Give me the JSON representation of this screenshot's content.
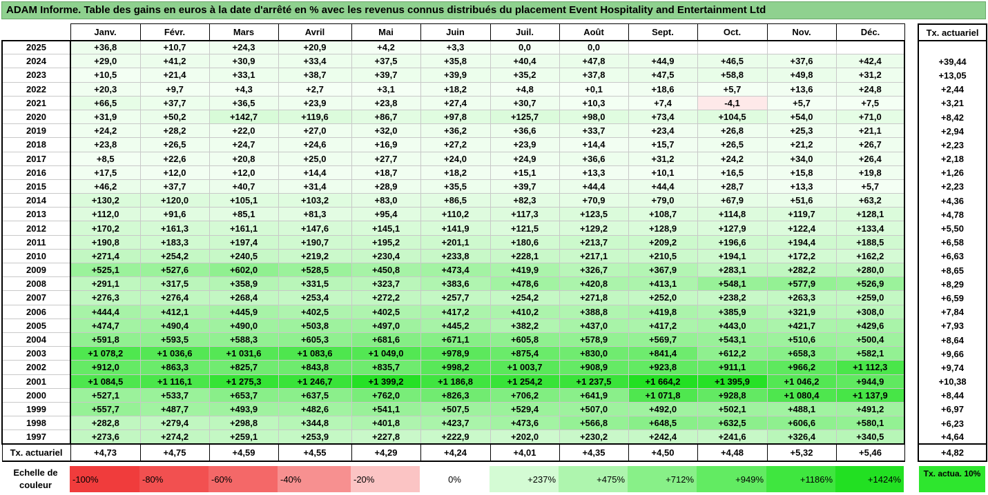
{
  "title": "ADAM Informe. Table des gains en euros à la date d'arrêté en % avec les revenus connus distribués du placement Event Hospitality and Entertainment Ltd",
  "chart_data": {
    "type": "table",
    "columns": [
      "Janv.",
      "Févr.",
      "Mars",
      "Avril",
      "Mai",
      "Juin",
      "Juil.",
      "Août",
      "Sept.",
      "Oct.",
      "Nov.",
      "Déc."
    ],
    "right_header": "Tx. actuariel",
    "rows": [
      {
        "year": "2025",
        "values": [
          "+36,8",
          "+10,7",
          "+24,3",
          "+20,9",
          "+4,2",
          "+3,3",
          "0,0",
          "0,0",
          "",
          "",
          "",
          ""
        ],
        "tx": ""
      },
      {
        "year": "2024",
        "values": [
          "+29,0",
          "+41,2",
          "+30,9",
          "+33,4",
          "+37,5",
          "+35,8",
          "+40,4",
          "+47,8",
          "+44,9",
          "+46,5",
          "+37,6",
          "+42,4"
        ],
        "tx": "+39,44"
      },
      {
        "year": "2023",
        "values": [
          "+10,5",
          "+21,4",
          "+33,1",
          "+38,7",
          "+39,7",
          "+39,9",
          "+35,2",
          "+37,8",
          "+47,5",
          "+58,8",
          "+49,8",
          "+31,2"
        ],
        "tx": "+13,05"
      },
      {
        "year": "2022",
        "values": [
          "+20,3",
          "+9,7",
          "+4,3",
          "+2,7",
          "+3,1",
          "+18,2",
          "+4,8",
          "+0,1",
          "+18,6",
          "+5,7",
          "+13,6",
          "+24,8"
        ],
        "tx": "+2,44"
      },
      {
        "year": "2021",
        "values": [
          "+66,5",
          "+37,7",
          "+36,5",
          "+23,9",
          "+23,8",
          "+27,4",
          "+30,7",
          "+10,3",
          "+7,4",
          "-4,1",
          "+5,7",
          "+7,5"
        ],
        "tx": "+3,21"
      },
      {
        "year": "2020",
        "values": [
          "+31,9",
          "+50,2",
          "+142,7",
          "+119,6",
          "+86,7",
          "+97,8",
          "+125,7",
          "+98,0",
          "+73,4",
          "+104,5",
          "+54,0",
          "+71,0"
        ],
        "tx": "+8,42"
      },
      {
        "year": "2019",
        "values": [
          "+24,2",
          "+28,2",
          "+22,0",
          "+27,0",
          "+32,0",
          "+36,2",
          "+36,6",
          "+33,7",
          "+23,4",
          "+26,8",
          "+25,3",
          "+21,1"
        ],
        "tx": "+2,94"
      },
      {
        "year": "2018",
        "values": [
          "+23,8",
          "+26,5",
          "+24,7",
          "+24,6",
          "+16,9",
          "+27,2",
          "+23,9",
          "+14,4",
          "+15,7",
          "+26,5",
          "+21,2",
          "+26,7"
        ],
        "tx": "+2,23"
      },
      {
        "year": "2017",
        "values": [
          "+8,5",
          "+22,6",
          "+20,8",
          "+25,0",
          "+27,7",
          "+24,0",
          "+24,9",
          "+36,6",
          "+31,2",
          "+24,2",
          "+34,0",
          "+26,4"
        ],
        "tx": "+2,18"
      },
      {
        "year": "2016",
        "values": [
          "+17,5",
          "+12,0",
          "+12,0",
          "+14,4",
          "+18,7",
          "+18,2",
          "+15,1",
          "+13,3",
          "+10,1",
          "+16,5",
          "+15,8",
          "+19,8"
        ],
        "tx": "+1,26"
      },
      {
        "year": "2015",
        "values": [
          "+46,2",
          "+37,7",
          "+40,7",
          "+31,4",
          "+28,9",
          "+35,5",
          "+39,7",
          "+44,4",
          "+44,4",
          "+28,7",
          "+13,3",
          "+5,7"
        ],
        "tx": "+2,23"
      },
      {
        "year": "2014",
        "values": [
          "+130,2",
          "+120,0",
          "+105,1",
          "+103,2",
          "+83,0",
          "+86,5",
          "+82,3",
          "+70,9",
          "+79,0",
          "+67,9",
          "+51,6",
          "+63,2"
        ],
        "tx": "+4,36"
      },
      {
        "year": "2013",
        "values": [
          "+112,0",
          "+91,6",
          "+85,1",
          "+81,3",
          "+95,4",
          "+110,2",
          "+117,3",
          "+123,5",
          "+108,7",
          "+114,8",
          "+119,7",
          "+128,1"
        ],
        "tx": "+4,78"
      },
      {
        "year": "2012",
        "values": [
          "+170,2",
          "+161,3",
          "+161,1",
          "+147,6",
          "+145,1",
          "+141,9",
          "+121,5",
          "+129,2",
          "+128,9",
          "+127,9",
          "+122,4",
          "+133,4"
        ],
        "tx": "+5,50"
      },
      {
        "year": "2011",
        "values": [
          "+190,8",
          "+183,3",
          "+197,4",
          "+190,7",
          "+195,2",
          "+201,1",
          "+180,6",
          "+213,7",
          "+209,2",
          "+196,6",
          "+194,4",
          "+188,5"
        ],
        "tx": "+6,58"
      },
      {
        "year": "2010",
        "values": [
          "+271,4",
          "+254,2",
          "+240,5",
          "+219,2",
          "+230,4",
          "+233,8",
          "+228,1",
          "+217,1",
          "+210,5",
          "+194,1",
          "+172,2",
          "+162,2"
        ],
        "tx": "+6,63"
      },
      {
        "year": "2009",
        "values": [
          "+525,1",
          "+527,6",
          "+602,0",
          "+528,5",
          "+450,8",
          "+473,4",
          "+419,9",
          "+326,7",
          "+367,9",
          "+283,1",
          "+282,2",
          "+280,0"
        ],
        "tx": "+8,65"
      },
      {
        "year": "2008",
        "values": [
          "+291,1",
          "+317,5",
          "+358,9",
          "+331,5",
          "+323,7",
          "+383,6",
          "+478,6",
          "+420,8",
          "+413,1",
          "+548,1",
          "+577,9",
          "+526,9"
        ],
        "tx": "+8,29"
      },
      {
        "year": "2007",
        "values": [
          "+276,3",
          "+276,4",
          "+268,4",
          "+253,4",
          "+272,2",
          "+257,7",
          "+254,2",
          "+271,8",
          "+252,0",
          "+238,2",
          "+263,3",
          "+259,0"
        ],
        "tx": "+6,59"
      },
      {
        "year": "2006",
        "values": [
          "+444,4",
          "+412,1",
          "+445,9",
          "+402,5",
          "+402,5",
          "+417,2",
          "+410,2",
          "+388,8",
          "+419,8",
          "+385,9",
          "+321,9",
          "+308,0"
        ],
        "tx": "+7,84"
      },
      {
        "year": "2005",
        "values": [
          "+474,7",
          "+490,4",
          "+490,0",
          "+503,8",
          "+497,0",
          "+445,2",
          "+382,2",
          "+437,0",
          "+417,2",
          "+443,0",
          "+421,7",
          "+429,6"
        ],
        "tx": "+7,93"
      },
      {
        "year": "2004",
        "values": [
          "+591,8",
          "+593,5",
          "+588,3",
          "+605,3",
          "+681,6",
          "+671,1",
          "+605,8",
          "+578,9",
          "+569,7",
          "+543,1",
          "+510,6",
          "+500,4"
        ],
        "tx": "+8,64"
      },
      {
        "year": "2003",
        "values": [
          "+1 078,2",
          "+1 036,6",
          "+1 031,6",
          "+1 083,6",
          "+1 049,0",
          "+978,9",
          "+875,4",
          "+830,0",
          "+841,4",
          "+612,2",
          "+658,3",
          "+582,1"
        ],
        "tx": "+9,66"
      },
      {
        "year": "2002",
        "values": [
          "+912,0",
          "+863,3",
          "+825,7",
          "+843,8",
          "+835,7",
          "+998,2",
          "+1 003,7",
          "+908,9",
          "+923,8",
          "+911,1",
          "+966,2",
          "+1 112,3"
        ],
        "tx": "+9,74"
      },
      {
        "year": "2001",
        "values": [
          "+1 084,5",
          "+1 116,1",
          "+1 275,3",
          "+1 246,7",
          "+1 399,2",
          "+1 186,8",
          "+1 254,2",
          "+1 237,5",
          "+1 664,2",
          "+1 395,9",
          "+1 046,2",
          "+944,9"
        ],
        "tx": "+10,38"
      },
      {
        "year": "2000",
        "values": [
          "+527,1",
          "+533,7",
          "+653,7",
          "+637,5",
          "+762,0",
          "+826,3",
          "+706,2",
          "+641,9",
          "+1 071,8",
          "+928,8",
          "+1 080,4",
          "+1 137,9"
        ],
        "tx": "+8,44"
      },
      {
        "year": "1999",
        "values": [
          "+557,7",
          "+487,7",
          "+493,9",
          "+482,6",
          "+541,1",
          "+507,5",
          "+529,4",
          "+507,0",
          "+492,0",
          "+502,1",
          "+488,1",
          "+491,2"
        ],
        "tx": "+6,97"
      },
      {
        "year": "1998",
        "values": [
          "+282,8",
          "+279,4",
          "+298,8",
          "+344,8",
          "+401,8",
          "+423,7",
          "+473,6",
          "+566,8",
          "+648,5",
          "+632,5",
          "+606,6",
          "+580,1"
        ],
        "tx": "+6,23"
      },
      {
        "year": "1997",
        "values": [
          "+273,6",
          "+274,2",
          "+259,1",
          "+253,9",
          "+227,8",
          "+222,9",
          "+202,0",
          "+230,2",
          "+242,4",
          "+241,6",
          "+326,4",
          "+340,5"
        ],
        "tx": "+4,64"
      }
    ],
    "footer": {
      "label": "Tx. actuariel",
      "values": [
        "+4,73",
        "+4,75",
        "+4,59",
        "+4,55",
        "+4,29",
        "+4,24",
        "+4,01",
        "+4,35",
        "+4,50",
        "+4,48",
        "+5,32",
        "+5,46"
      ],
      "tx": "+4,82"
    }
  },
  "legend": {
    "label": "Echelle de couleur",
    "items": [
      {
        "text": "-100%",
        "color": "#f03c3c",
        "kind": "neg"
      },
      {
        "text": "-80%",
        "color": "#f25050",
        "kind": "neg"
      },
      {
        "text": "-60%",
        "color": "#f46868",
        "kind": "neg"
      },
      {
        "text": "-40%",
        "color": "#f79090",
        "kind": "neg"
      },
      {
        "text": "-20%",
        "color": "#fbc4c4",
        "kind": "neg"
      },
      {
        "text": "0%",
        "color": "#ffffff",
        "kind": "zero"
      },
      {
        "text": "+237%",
        "color": "#d4fbd4",
        "kind": "pos"
      },
      {
        "text": "+475%",
        "color": "#aef5ae",
        "kind": "pos"
      },
      {
        "text": "+712%",
        "color": "#88f088",
        "kind": "pos"
      },
      {
        "text": "+949%",
        "color": "#62eb62",
        "kind": "pos"
      },
      {
        "text": "+1186%",
        "color": "#3fe63f",
        "kind": "pos"
      },
      {
        "text": "+1424%",
        "color": "#22e022",
        "kind": "pos"
      }
    ],
    "tx_label": "Tx. actua. 10%"
  }
}
